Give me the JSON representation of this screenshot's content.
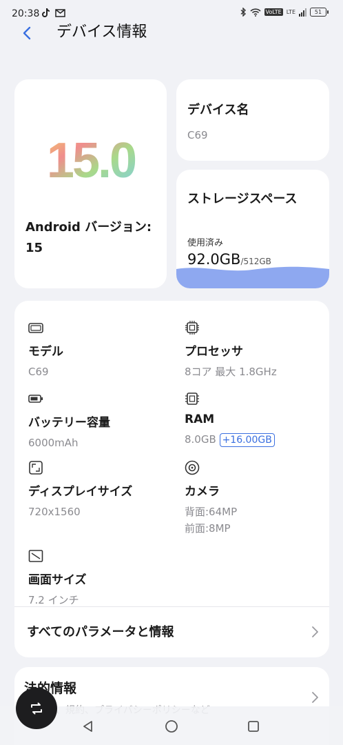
{
  "status_bar": {
    "time": "20:38",
    "left_icons": [
      "tiktok-icon",
      "mail-icon"
    ],
    "right_icons": [
      "bluetooth-icon",
      "wifi-icon",
      "volte-icon",
      "lte-icon",
      "signal-icon",
      "battery-icon"
    ],
    "volte": "VoLTE",
    "lte": "LTE",
    "battery": "51"
  },
  "header": {
    "title": "デバイス情報"
  },
  "version_card": {
    "logo_text": "15.0",
    "label": "Android バージョン: 15"
  },
  "device_name_card": {
    "title": "デバイス名",
    "value": "C69"
  },
  "storage_card": {
    "title": "ストレージスペース",
    "used_label": "使用済み",
    "used": "92.0GB",
    "total": "/512GB",
    "used_fraction": 0.18,
    "wave_color": "#8ea8f0"
  },
  "specs": {
    "model": {
      "title": "モデル",
      "value": "C69",
      "icon": "phone-icon"
    },
    "processor": {
      "title": "プロセッサ",
      "value": "8コア 最大 1.8GHz",
      "icon": "chip-icon"
    },
    "battery": {
      "title": "バッテリー容量",
      "value": "6000mAh",
      "icon": "battery-icon"
    },
    "ram": {
      "title": "RAM",
      "value": "8.0GB",
      "extra": "+16.00GB",
      "icon": "memory-icon"
    },
    "display": {
      "title": "ディスプレイサイズ",
      "value": "720x1560",
      "icon": "display-icon"
    },
    "camera": {
      "title": "カメラ",
      "rear": "背面:64MP",
      "front": "前面:8MP",
      "icon": "camera-icon"
    },
    "screen": {
      "title": "画面サイズ",
      "value": "7.2 インチ",
      "icon": "screen-size-icon"
    }
  },
  "all_params": {
    "label": "すべてのパラメータと情報"
  },
  "legal": {
    "title": "法的情報",
    "subtitle": "、規約、プライバシーポリシーなど"
  },
  "accent_color": "#3a6fe0"
}
